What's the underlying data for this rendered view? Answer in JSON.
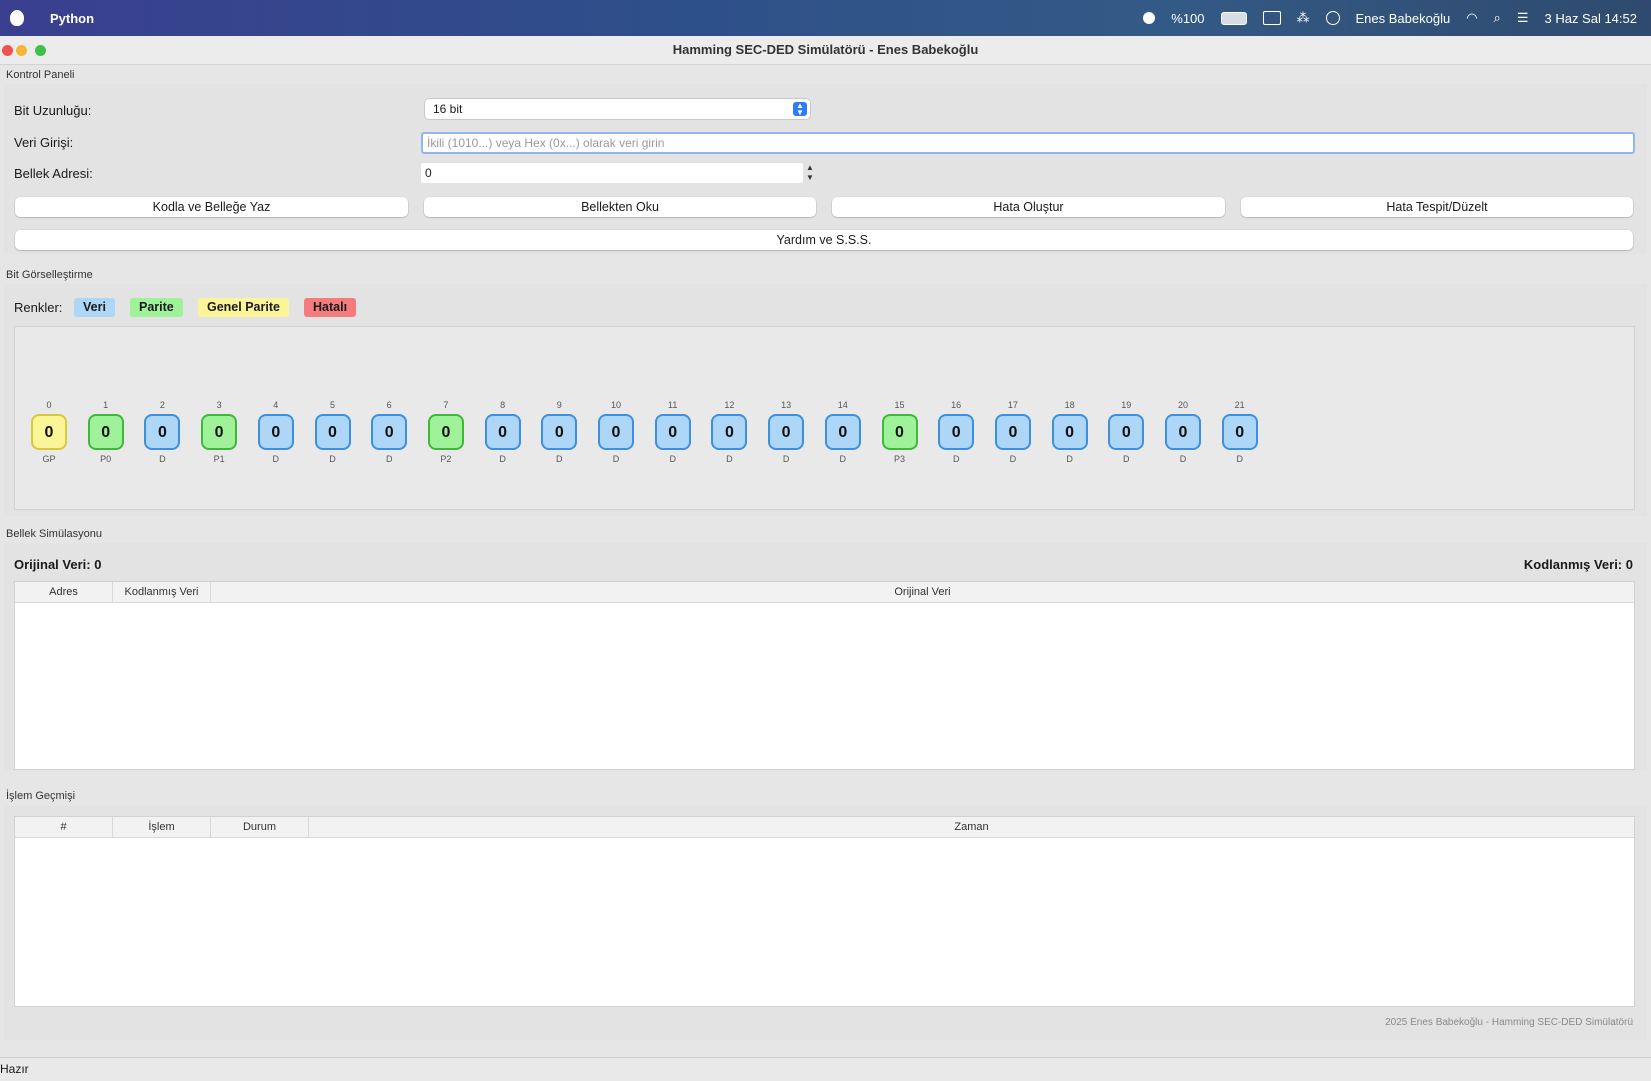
{
  "menubar": {
    "app_name": "Python",
    "battery": "%100",
    "user": "Enes Babekoğlu",
    "datetime": "3 Haz Sal  14:52"
  },
  "window": {
    "title": "Hamming SEC-DED Simülatörü - Enes Babekoğlu"
  },
  "control_panel": {
    "section_title": "Kontrol Paneli",
    "bit_length_label": "Bit Uzunluğu:",
    "bit_length_value": "16 bit",
    "data_input_label": "Veri Girişi:",
    "data_input_placeholder": "İkili (1010...) veya Hex (0x...) olarak veri girin",
    "memory_address_label": "Bellek Adresi:",
    "memory_address_value": "0",
    "buttons": {
      "encode": "Kodla ve Belleğe Yaz",
      "read": "Bellekten Oku",
      "inject_error": "Hata Oluştur",
      "detect_fix": "Hata Tespit/Düzelt",
      "help": "Yardım ve S.S.S."
    }
  },
  "bit_visual": {
    "section_title": "Bit Görselleştirme",
    "legend_label": "Renkler:",
    "legend": [
      {
        "label": "Veri",
        "color": "#aed6f7"
      },
      {
        "label": "Parite",
        "color": "#9ff29a"
      },
      {
        "label": "Genel Parite",
        "color": "#fbf59a"
      },
      {
        "label": "Hatalı",
        "color": "#f47c7c"
      }
    ],
    "bits": [
      {
        "index": "0",
        "value": "0",
        "label": "GP",
        "kind": "gp"
      },
      {
        "index": "1",
        "value": "0",
        "label": "P0",
        "kind": "p"
      },
      {
        "index": "2",
        "value": "0",
        "label": "D",
        "kind": "d"
      },
      {
        "index": "3",
        "value": "0",
        "label": "P1",
        "kind": "p"
      },
      {
        "index": "4",
        "value": "0",
        "label": "D",
        "kind": "d"
      },
      {
        "index": "5",
        "value": "0",
        "label": "D",
        "kind": "d"
      },
      {
        "index": "6",
        "value": "0",
        "label": "D",
        "kind": "d"
      },
      {
        "index": "7",
        "value": "0",
        "label": "P2",
        "kind": "p"
      },
      {
        "index": "8",
        "value": "0",
        "label": "D",
        "kind": "d"
      },
      {
        "index": "9",
        "value": "0",
        "label": "D",
        "kind": "d"
      },
      {
        "index": "10",
        "value": "0",
        "label": "D",
        "kind": "d"
      },
      {
        "index": "11",
        "value": "0",
        "label": "D",
        "kind": "d"
      },
      {
        "index": "12",
        "value": "0",
        "label": "D",
        "kind": "d"
      },
      {
        "index": "13",
        "value": "0",
        "label": "D",
        "kind": "d"
      },
      {
        "index": "14",
        "value": "0",
        "label": "D",
        "kind": "d"
      },
      {
        "index": "15",
        "value": "0",
        "label": "P3",
        "kind": "p"
      },
      {
        "index": "16",
        "value": "0",
        "label": "D",
        "kind": "d"
      },
      {
        "index": "17",
        "value": "0",
        "label": "D",
        "kind": "d"
      },
      {
        "index": "18",
        "value": "0",
        "label": "D",
        "kind": "d"
      },
      {
        "index": "19",
        "value": "0",
        "label": "D",
        "kind": "d"
      },
      {
        "index": "20",
        "value": "0",
        "label": "D",
        "kind": "d"
      },
      {
        "index": "21",
        "value": "0",
        "label": "D",
        "kind": "d"
      }
    ]
  },
  "memory": {
    "section_title": "Bellek Simülasyonu",
    "original_label": "Orijinal Veri:",
    "original_value": "0",
    "encoded_label": "Kodlanmış Veri:",
    "encoded_value": "0",
    "columns": [
      "Adres",
      "Kodlanmış Veri",
      "Orijinal Veri"
    ]
  },
  "history": {
    "section_title": "İşlem Geçmişi",
    "columns": [
      "#",
      "İşlem",
      "Durum",
      "Zaman"
    ]
  },
  "footer_note": "2025 Enes Babekoğlu - Hamming SEC-DED Simülatörü",
  "status": "Hazır"
}
